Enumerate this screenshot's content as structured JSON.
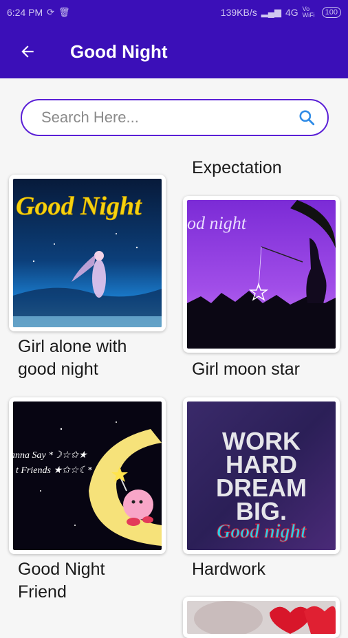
{
  "status": {
    "time": "6:24 PM",
    "network": "139KB/s",
    "signal": "4G",
    "vowifi": "Vo WiFi",
    "battery": "100"
  },
  "appbar": {
    "title": "Good Night"
  },
  "search": {
    "placeholder": "Search Here..."
  },
  "grid": {
    "top_right_caption": "Expectation",
    "items": [
      {
        "caption_line1": "Girl alone with",
        "caption_line2": "good night",
        "overlay": "Good Night"
      },
      {
        "caption_line1": "Girl moon star",
        "caption_line2": "",
        "overlay": "od night"
      },
      {
        "caption_line1": "Good Night",
        "caption_line2": "Friend",
        "overlay_line1": "anna Say *☽☆✩★",
        "overlay_line2": "t Friends ★✩☆☾*"
      },
      {
        "caption_line1": "Hardwork",
        "caption_line2": "",
        "overlay_line1": "WORK",
        "overlay_line2": "HARD",
        "overlay_line3": "DREAM",
        "overlay_line4": "BIG.",
        "overlay_line5": "Good night"
      }
    ]
  }
}
